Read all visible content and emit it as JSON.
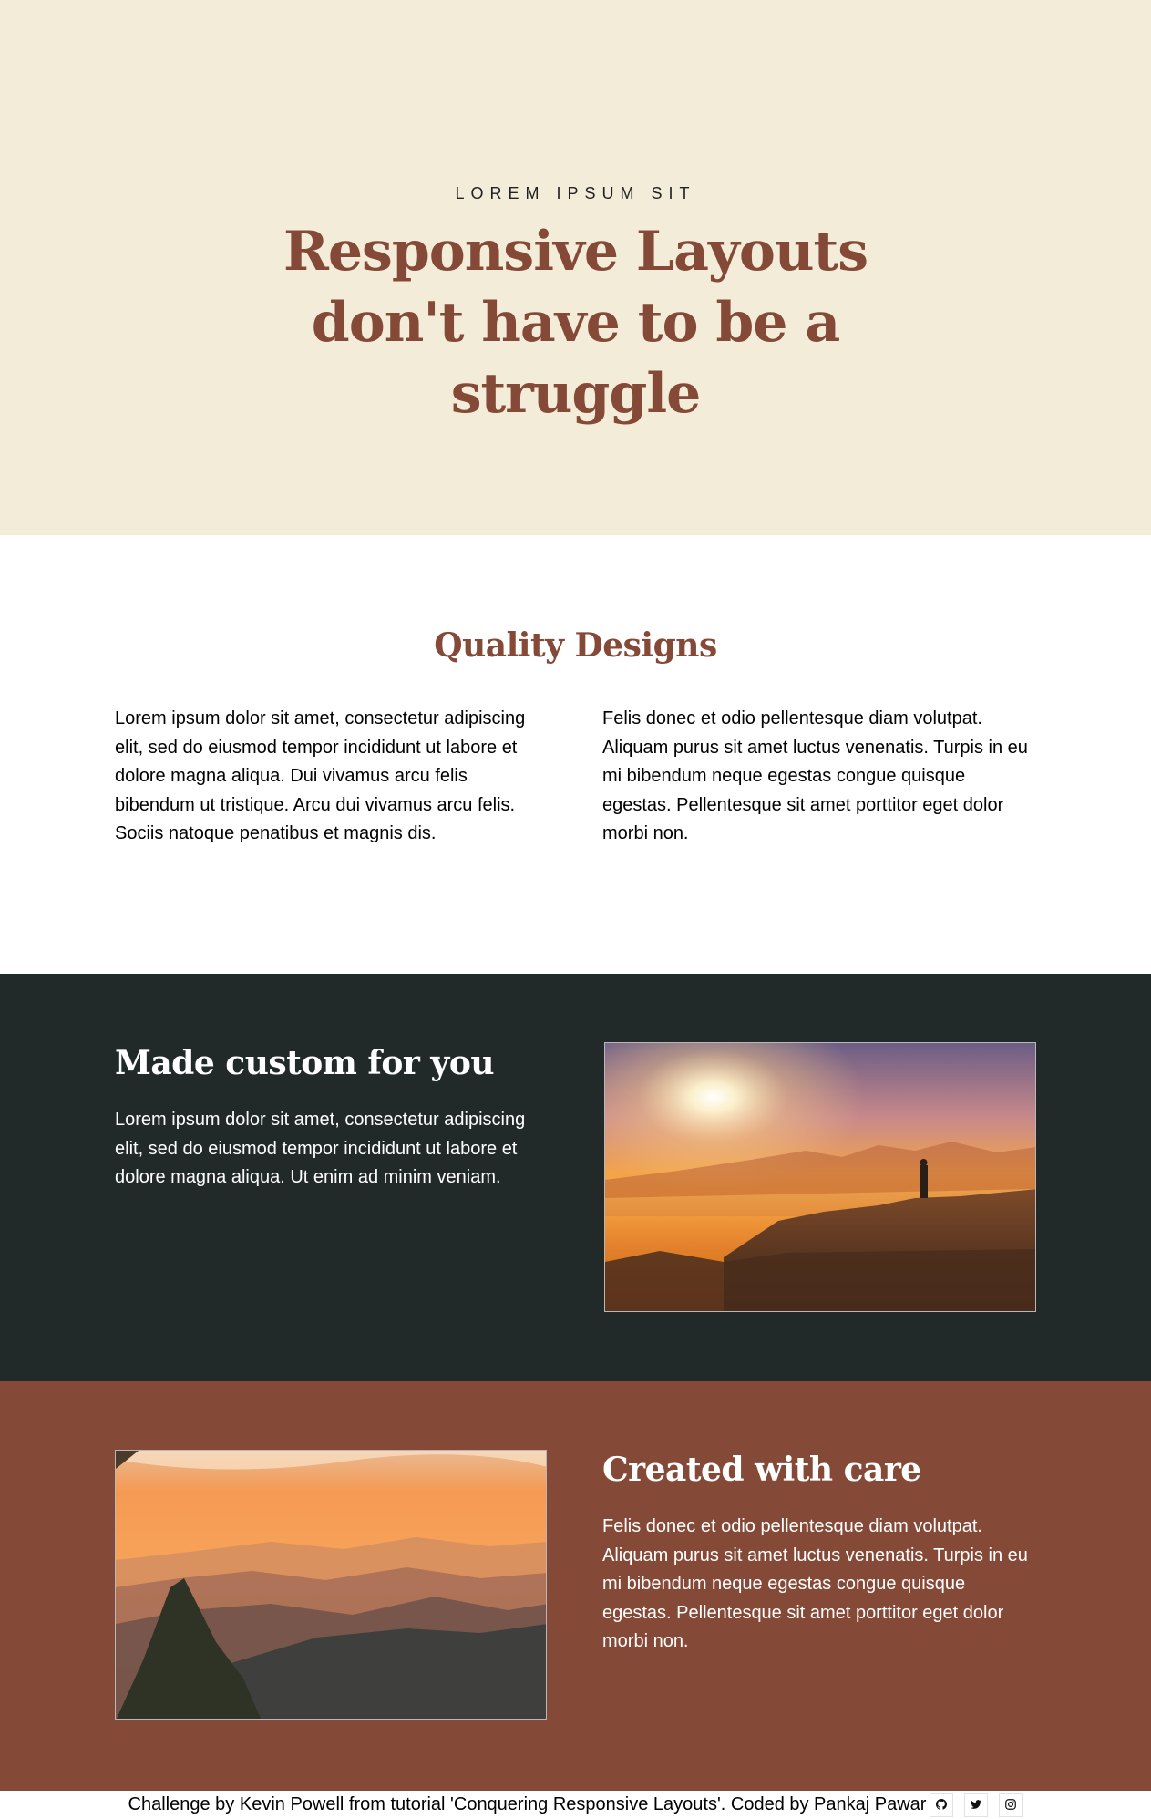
{
  "hero": {
    "eyebrow": "LOREM IPSUM SIT",
    "title": "Responsive Layouts don't have to be a struggle"
  },
  "quality": {
    "title": "Quality Designs",
    "left_text": "Lorem ipsum dolor sit amet, consectetur adipiscing elit, sed do eiusmod tempor incididunt ut labore et dolore magna aliqua. Dui vivamus arcu felis bibendum ut tristique. Arcu dui vivamus arcu felis. Sociis natoque penatibus et magnis dis.",
    "right_text": "Felis donec et odio pellentesque diam volutpat. Aliquam purus sit amet luctus venenatis. Turpis in eu mi bibendum neque egestas congue quisque egestas. Pellentesque sit amet porttitor eget dolor morbi non."
  },
  "custom": {
    "title": "Made custom for you",
    "text": "Lorem ipsum dolor sit amet, consectetur adipiscing elit, sed do eiusmod tempor incididunt ut labore et dolore magna aliqua. Ut enim ad minim veniam."
  },
  "care": {
    "title": "Created with care",
    "text": "Felis donec et odio pellentesque diam volutpat. Aliquam purus sit amet luctus venenatis. Turpis in eu mi bibendum neque egestas congue quisque egestas. Pellentesque sit amet porttitor eget dolor morbi non."
  },
  "footer": {
    "text": "Challenge by Kevin Powell from tutorial 'Conquering Responsive Layouts'. Coded by Pankaj Pawar",
    "icons": [
      "github-icon",
      "twitter-icon",
      "instagram-icon"
    ]
  },
  "colors": {
    "hero_bg": "#f3ecd8",
    "accent": "#854a37",
    "dark_bg": "#222a29",
    "brown_bg": "#854a37"
  }
}
